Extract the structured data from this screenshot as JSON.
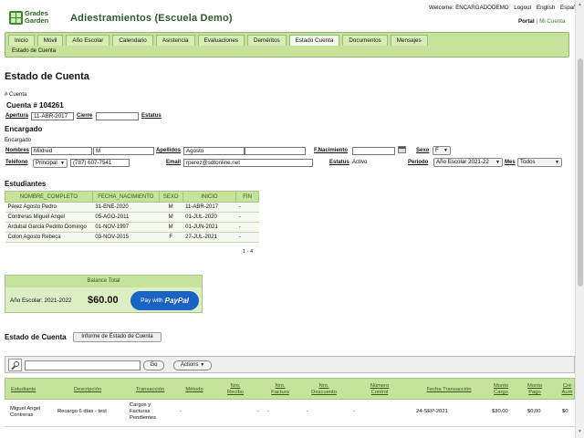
{
  "app": {
    "logo_line1": "Grades",
    "logo_line2": "Garden",
    "title": "Adiestramientos (Escuela Demo)"
  },
  "top_links": {
    "welcome": "Welcome: ENCARGADODEMO",
    "logout": "Logout",
    "english": "English",
    "espanol": "Español"
  },
  "portal_links": {
    "portal": "Portal",
    "separator": "|",
    "mi_cuenta": "Mi Cuenta"
  },
  "nav": {
    "tabs": [
      "Inicio",
      "Móvil",
      "Año Escolar",
      "Calendario",
      "Asistencia",
      "Evaluaciones",
      "Deméritos",
      "Estado Cuenta",
      "Documentos",
      "Mensajes"
    ],
    "active": "Estado Cuenta",
    "sub_tab": "Estado de Cuenta"
  },
  "page": {
    "title": "Estado de Cuenta",
    "hash_cuenta": "# Cuenta",
    "cuenta_num": "Cuenta # 104261"
  },
  "apertura": {
    "label": "Apertura",
    "value": "11-ABR-2017"
  },
  "cierre": {
    "label": "Cierre",
    "value": ""
  },
  "estatus_top": {
    "label": "Estatus"
  },
  "encargado": {
    "title": "Encargado",
    "subtitle": "Encargado",
    "nombres_label": "Nombres",
    "nombres_value": "Mildred",
    "inicial_value": "M",
    "apellidos_label": "Apellidos",
    "apellido1": "Agosto",
    "apellido2": "",
    "nacimiento_label": "F.Nacimiento",
    "nacimiento_value": "",
    "sexo_label": "Sexo",
    "sexo_value": "F",
    "telefono_label": "Teléfono",
    "telefono_tipo": "Principal",
    "telefono_value": "(787) 607-7541",
    "email_label": "Email",
    "email_value": "rperez@sdtonline.net",
    "estatus_label": "Estatus",
    "estatus_value": "Activo",
    "periodo_label": "Período",
    "periodo_value": "Año Escolar 2021-22",
    "mes_label": "Mes",
    "mes_value": "Todos"
  },
  "students": {
    "title": "Estudiantes",
    "columns": [
      "NOMBRE_COMPLETO",
      "FECHA_NACIMIENTO",
      "SEXO",
      "INICIO",
      "FIN"
    ],
    "rows": [
      [
        "Pérez Agosto Pedro",
        "31-ENE-2020",
        "M",
        "11-ABR-2017",
        "-"
      ],
      [
        "Contreras Miguel Angel",
        "05-AGO-2011",
        "M",
        "01-JUL-2020",
        "-"
      ],
      [
        "Ardubal Garcia Pedrito Domingo",
        "01-NOV-1997",
        "M",
        "01-JUN-2021",
        "-"
      ],
      [
        "Colon Agosto Rebeca",
        "03-NOV-2015",
        "F",
        "27-JUL-2021",
        "-"
      ]
    ],
    "pager": "1 - 4"
  },
  "balance": {
    "header": "Balance Total",
    "year": "Año Escolar: 2021-2022",
    "amount": "$60.00",
    "paypal_prefix": "Pay with",
    "paypal_brand": "PayPal"
  },
  "estado": {
    "title": "Estado de Cuenta",
    "report_button": "Informe de Estado de Cuenta"
  },
  "toolbar": {
    "search_value": "",
    "go": "Go",
    "actions": "Actions"
  },
  "transactions": {
    "columns": [
      "Estudiante",
      "Descripción",
      "Transacción",
      "Método",
      "Nro. Recibo",
      "Nro. Factura",
      "Nro. Descuento",
      "Número Control",
      "Fecha Transacción",
      "Monto Cargo",
      "Monto Pago",
      "Cré Aum"
    ],
    "row": {
      "estudiante": "Miguel Angel Contreras",
      "descripcion": "Recargo 6 días - test",
      "transaccion": "Cargos y Facturas Pendientes",
      "metodo": "-",
      "recibo": "-",
      "factura": "-",
      "descuento": "-",
      "control": "-",
      "fecha": "24-SEP-2021",
      "cargo": "$30,00",
      "pago": "$0,00",
      "credito": "$0"
    }
  }
}
